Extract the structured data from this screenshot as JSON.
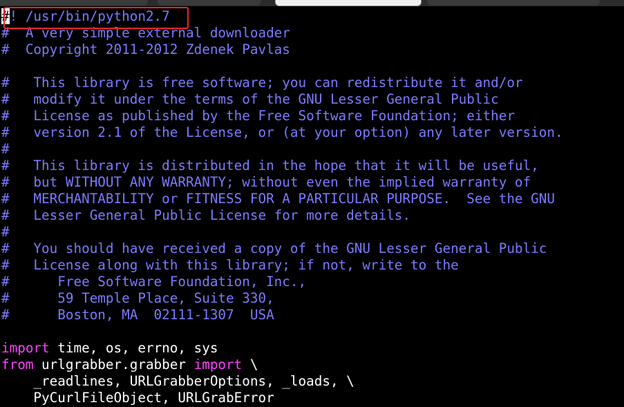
{
  "tabs": [
    {
      "label": "",
      "active": false
    },
    {
      "label": "",
      "active": false
    },
    {
      "label": "",
      "active": true
    },
    {
      "label": "",
      "active": false
    }
  ],
  "editor": {
    "shebang": {
      "cursor": "#",
      "rest": "! /usr/bin/python2.7"
    },
    "comment_lines": [
      "#  A very simple external downloader",
      "#  Copyright 2011-2012 Zdenek Pavlas",
      "",
      "#   This library is free software; you can redistribute it and/or",
      "#   modify it under the terms of the GNU Lesser General Public",
      "#   License as published by the Free Software Foundation; either",
      "#   version 2.1 of the License, or (at your option) any later version.",
      "#",
      "#   This library is distributed in the hope that it will be useful,",
      "#   but WITHOUT ANY WARRANTY; without even the implied warranty of",
      "#   MERCHANTABILITY or FITNESS FOR A PARTICULAR PURPOSE.  See the GNU",
      "#   Lesser General Public License for more details.",
      "#",
      "#   You should have received a copy of the GNU Lesser General Public",
      "#   License along with this library; if not, write to the",
      "#      Free Software Foundation, Inc.,",
      "#      59 Temple Place, Suite 330,",
      "#      Boston, MA  02111-1307  USA"
    ],
    "import_line": {
      "keyword": "import",
      "rest": " time, os, errno, sys"
    },
    "from_line": {
      "keyword_from": "from",
      "module": " urlgrabber.grabber ",
      "keyword_import": "import",
      "rest": " \\"
    },
    "cont_line_1": "    _readlines, URLGrabberOptions, _loads, \\",
    "cont_line_2": "    PyCurlFileObject, URLGrabError"
  },
  "colors": {
    "background": "#000000",
    "comment": "#7b7bff",
    "keyword": "#ff40ff",
    "text": "#ffffff",
    "highlight_box": "#e8262c"
  }
}
